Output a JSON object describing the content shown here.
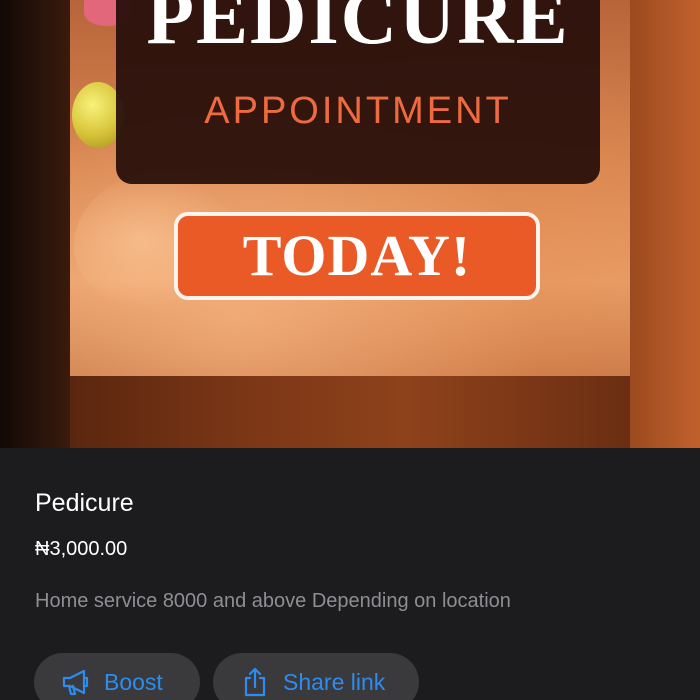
{
  "colors": {
    "background": "#1c1c1e",
    "accent": "#2d8cf0",
    "text_primary": "#ffffff",
    "text_secondary": "#8e8e93",
    "button_bg": "#3a3a3c",
    "badge_orange": "#ea5a26",
    "banner_text_orange": "#ef6a3e"
  },
  "product_image": {
    "headline": "PEDICURE",
    "subheadline": "APPOINTMENT",
    "badge": "TODAY!"
  },
  "product": {
    "name": "Pedicure",
    "price": "₦3,000.00",
    "description": "Home service 8000 and above Depending on location"
  },
  "actions": {
    "boost": {
      "label": "Boost",
      "icon": "megaphone-icon"
    },
    "share": {
      "label": "Share link",
      "icon": "share-icon"
    }
  }
}
